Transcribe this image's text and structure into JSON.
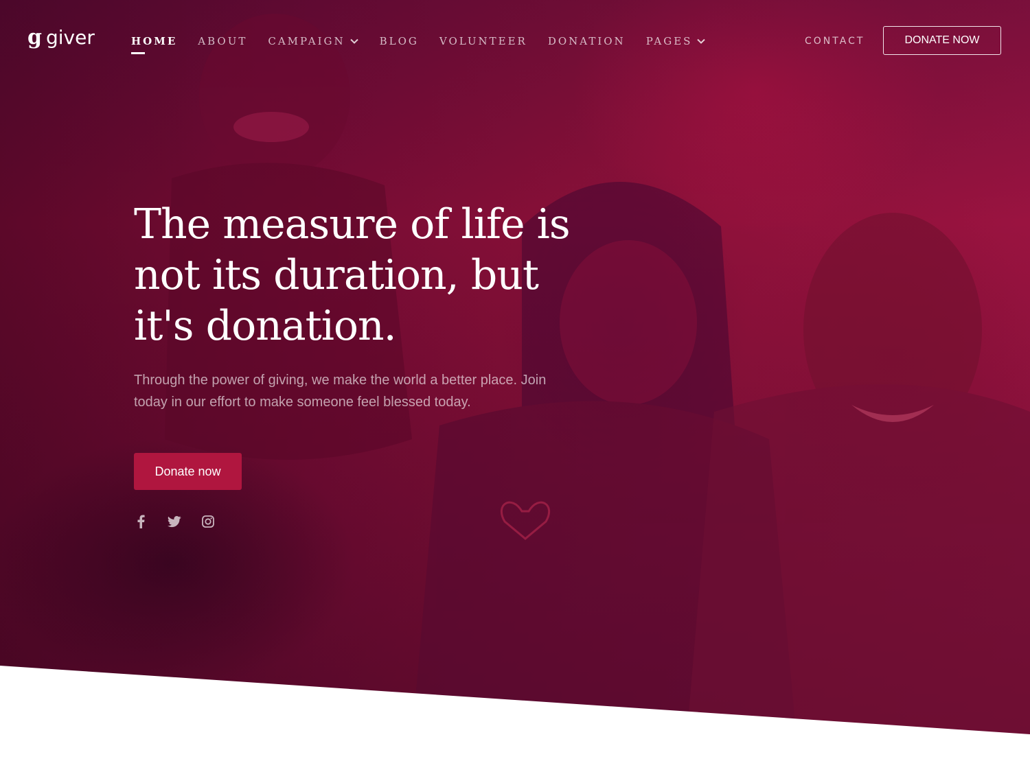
{
  "brand": {
    "logo_mark": "g",
    "logo_text": "giver"
  },
  "nav": {
    "items": [
      {
        "label": "HOME",
        "active": true,
        "has_dropdown": false
      },
      {
        "label": "ABOUT",
        "active": false,
        "has_dropdown": false
      },
      {
        "label": "CAMPAIGN",
        "active": false,
        "has_dropdown": true
      },
      {
        "label": "BLOG",
        "active": false,
        "has_dropdown": false
      },
      {
        "label": "VOLUNTEER",
        "active": false,
        "has_dropdown": false
      },
      {
        "label": "DONATION",
        "active": false,
        "has_dropdown": false
      },
      {
        "label": "PAGES",
        "active": false,
        "has_dropdown": true
      }
    ],
    "contact_label": "CONTACT",
    "donate_label": "DONATE NOW"
  },
  "hero": {
    "headline_lines": [
      "The measure of life is",
      "not its duration, but",
      "it's donation."
    ],
    "subtext": "Through the power of giving, we make the world a better place. Join today in our effort to make someone feel blessed today.",
    "cta_label": "Donate now",
    "socials": [
      {
        "icon": "facebook-icon"
      },
      {
        "icon": "twitter-icon"
      },
      {
        "icon": "instagram-icon"
      }
    ]
  },
  "colors": {
    "accent": "#b0163f",
    "overlay": "#8a1038",
    "background": "#ffffff"
  }
}
